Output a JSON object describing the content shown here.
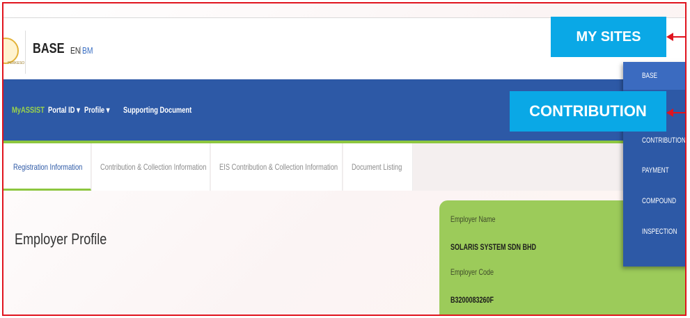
{
  "header": {
    "logo_text": "PERKESO",
    "brand": "BASE",
    "lang_en": "EN",
    "lang_bm": "BM"
  },
  "nav": {
    "items": [
      {
        "label": "MyASSIST"
      },
      {
        "label": "Portal ID ▾"
      },
      {
        "label": "Profile ▾"
      },
      {
        "label": "Supporting Document"
      }
    ]
  },
  "tabs": [
    {
      "label": "Registration Information",
      "active": true
    },
    {
      "label": "Contribution & Collection Information",
      "active": false
    },
    {
      "label": "EIS Contribution & Collection Information",
      "active": false
    },
    {
      "label": "Document Listing",
      "active": false
    }
  ],
  "page": {
    "title": "Employer Profile"
  },
  "employer_card": {
    "name_label": "Employer Name",
    "name_value": "SOLARIS SYSTEM SDN BHD",
    "code_label": "Employer Code",
    "code_value": "B3200083260F"
  },
  "my_sites_menu": {
    "items": [
      {
        "label": "BASE"
      },
      {
        "label": "CONTRIBUTION"
      },
      {
        "label": "PAYMENT"
      },
      {
        "label": "COMPOUND"
      },
      {
        "label": "INSPECTION"
      }
    ]
  },
  "callouts": {
    "my_sites": "MY SITES",
    "contribution": "CONTRIBUTION"
  },
  "colors": {
    "nav_blue": "#2d59a6",
    "accent_green": "#8dc63f",
    "callout_blue": "#0aa8e6",
    "annotation_red": "#e0141e"
  }
}
